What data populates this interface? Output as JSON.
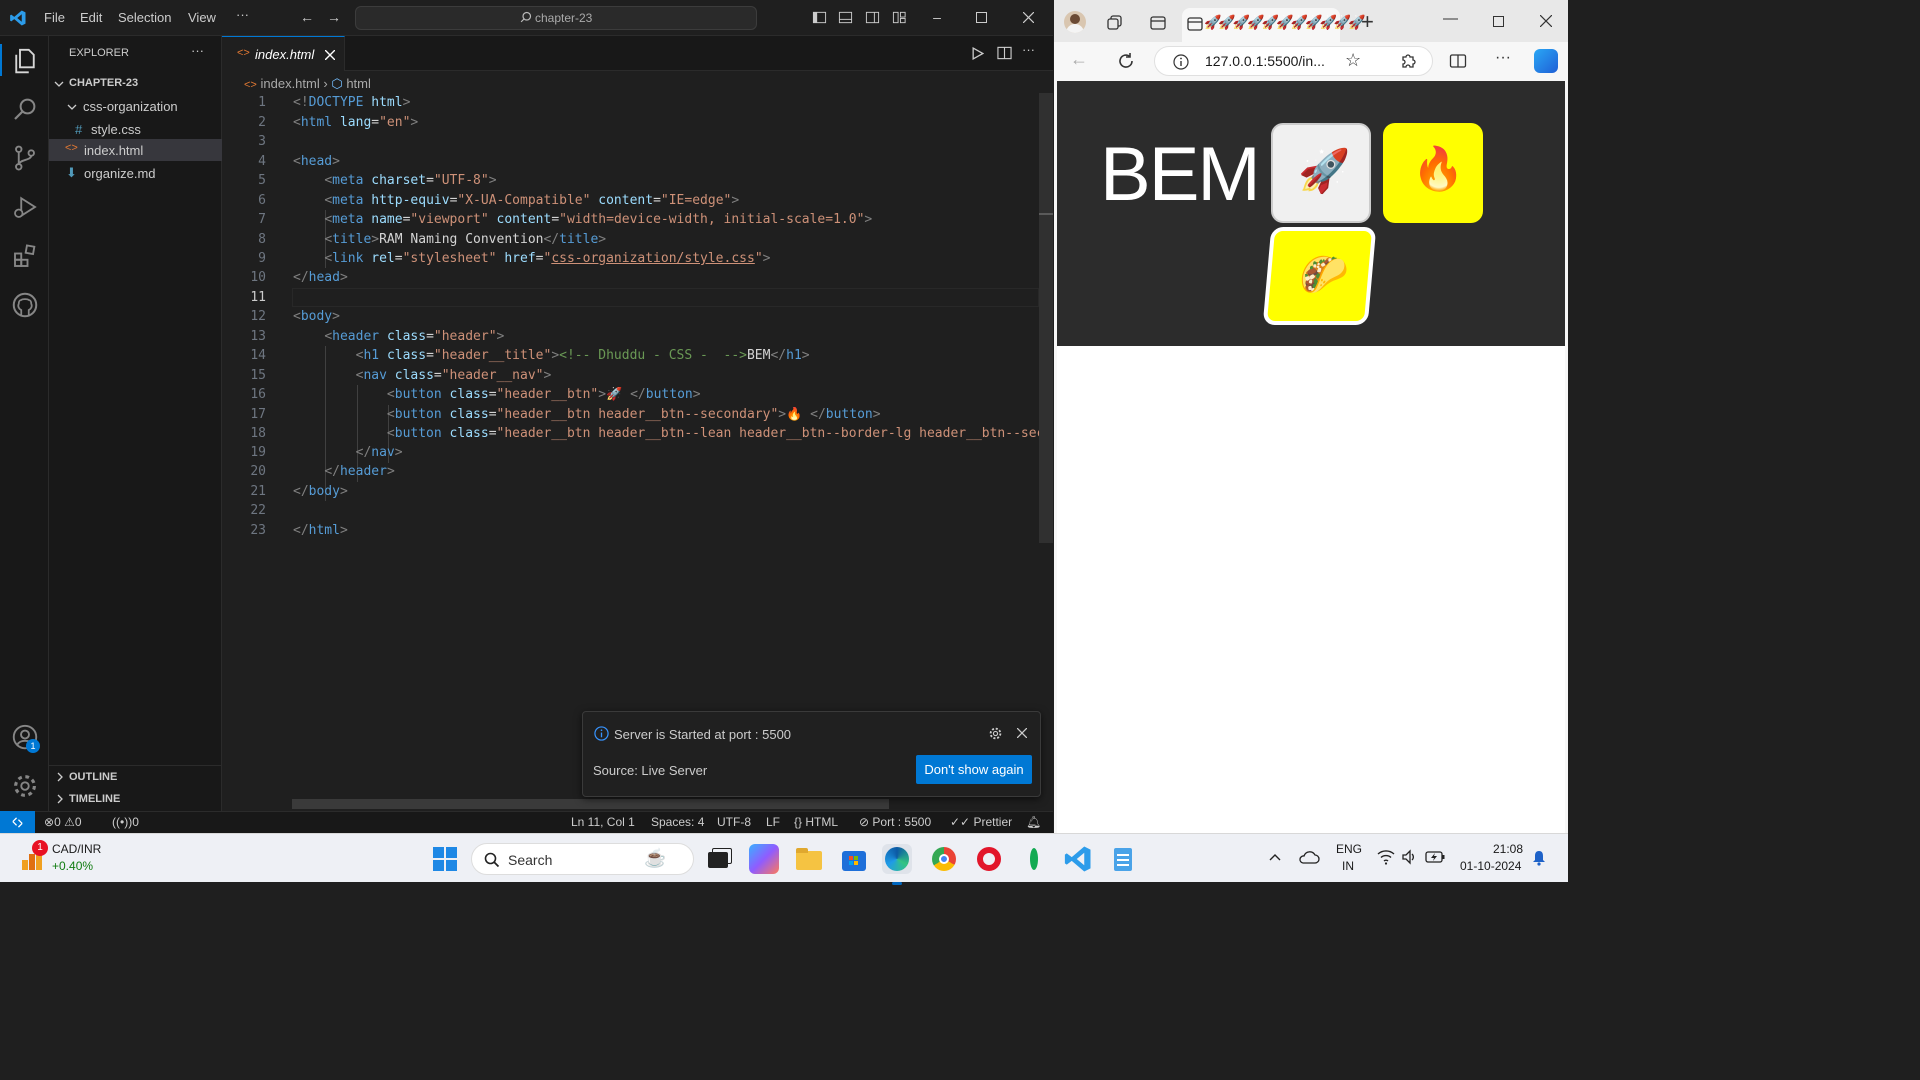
{
  "titlebar": {
    "menu": [
      "File",
      "Edit",
      "Selection",
      "View",
      "···"
    ],
    "command_center": "chapter-23"
  },
  "sidebar": {
    "title": "EXPLORER",
    "more": "···",
    "root": "CHAPTER-23",
    "items": [
      {
        "label": "css-organization",
        "icon": "chevron-down-icon"
      },
      {
        "label": "style.css",
        "icon": "css-hash-icon"
      },
      {
        "label": "index.html",
        "icon": "html-icon",
        "selected": true
      },
      {
        "label": "organize.md",
        "icon": "markdown-icon"
      }
    ],
    "outline": "OUTLINE",
    "timeline": "TIMELINE"
  },
  "editor": {
    "tab_label": "index.html",
    "breadcrumb": [
      "index.html",
      "html"
    ],
    "line_numbers": [
      "1",
      "2",
      "3",
      "4",
      "5",
      "6",
      "7",
      "8",
      "9",
      "10",
      "11",
      "12",
      "13",
      "14",
      "15",
      "16",
      "17",
      "18",
      "19",
      "20",
      "21",
      "22",
      "23"
    ],
    "current_line": "11"
  },
  "notification": {
    "message": "Server is Started at port : 5500",
    "source": "Source: Live Server",
    "action": "Don't show again"
  },
  "statusbar": {
    "errors": "0",
    "warnings": "0",
    "ports": "0",
    "position": "Ln 11, Col 1",
    "spaces": "Spaces: 4",
    "encoding": "UTF-8",
    "eol": "LF",
    "language": "HTML",
    "port": "Port : 5500",
    "formatter": "Prettier"
  },
  "browser": {
    "url": "127.0.0.1:5500/in...",
    "page": {
      "title": "BEM",
      "buttons": [
        {
          "icon": "rocket-icon",
          "bg": "#f0f0f0"
        },
        {
          "icon": "fire-icon",
          "bg": "#ffff00"
        },
        {
          "icon": "taco-icon",
          "bg": "#ffff00"
        }
      ]
    }
  },
  "taskbar": {
    "widget_title": "CAD/INR",
    "widget_value": "+0.40%",
    "widget_badge": "1",
    "search_placeholder": "Search",
    "lang_1": "ENG",
    "lang_2": "IN",
    "time": "21:08",
    "date": "01-10-2024"
  },
  "colors": {
    "accent": "#0078d4",
    "yellow": "#ffff00"
  }
}
